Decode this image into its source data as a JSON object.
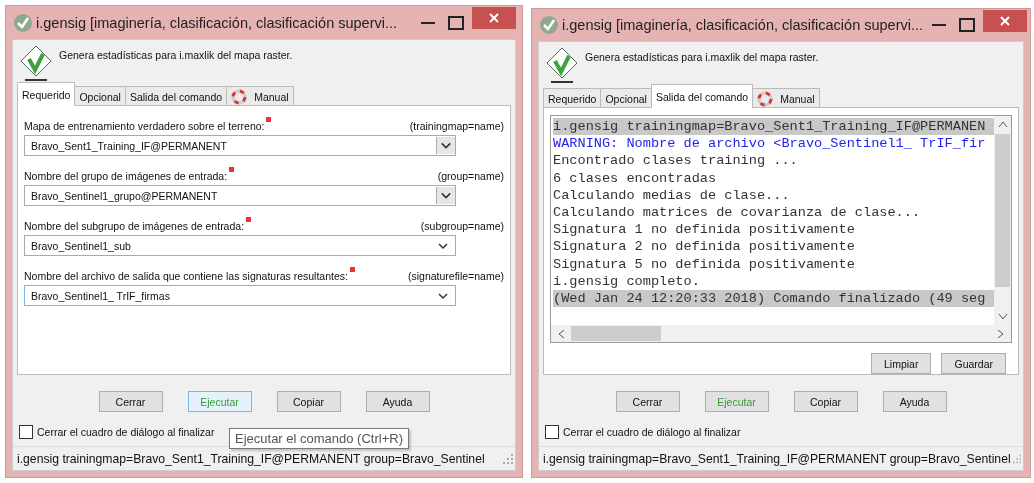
{
  "windows": [
    {
      "kind": "form",
      "title": "i.gensig [imaginería, clasificación, clasificación supervi...",
      "description": "Genera estadísticas para i.maxlik del mapa raster.",
      "tabs": [
        {
          "label": "Requerido",
          "selected": true,
          "kind": "text"
        },
        {
          "label": "Opcional",
          "selected": false,
          "kind": "text"
        },
        {
          "label": "Salida del comando",
          "selected": false,
          "kind": "text"
        },
        {
          "label": "Manual",
          "selected": false,
          "kind": "manual"
        }
      ],
      "fields": [
        {
          "label": "Mapa de entrenamiento verdadero sobre el terreno:",
          "required": true,
          "param": "(trainingmap=name)",
          "value": "Bravo_Sent1_Training_IF@PERMANENT",
          "kind": "select",
          "focused": false
        },
        {
          "label": "Nombre del grupo de imágenes de entrada:",
          "required": true,
          "param": "(group=name)",
          "value": "Bravo_Sentinel1_grupo@PERMANENT",
          "kind": "select",
          "focused": false
        },
        {
          "label": "Nombre del subgrupo de imágenes de entrada:",
          "required": true,
          "param": "(subgroup=name)",
          "value": "Bravo_Sentinel1_sub",
          "kind": "combo",
          "focused": false
        },
        {
          "label": "Nombre del archivo de salida que contiene las signaturas resultantes:",
          "required": true,
          "param": "(signaturefile=name)",
          "value": "Bravo_Sentinel1_ TrIF_firmas",
          "kind": "combo",
          "focused": true
        }
      ],
      "buttons": [
        {
          "label": "Cerrar",
          "focused": false,
          "kind": "plain"
        },
        {
          "label": "Ejecutar",
          "focused": true,
          "kind": "run"
        },
        {
          "label": "Copiar",
          "focused": false,
          "kind": "plain"
        },
        {
          "label": "Ayuda",
          "focused": false,
          "kind": "plain"
        }
      ],
      "close_checkbox": {
        "label": "Cerrar el cuadro de diálogo al finalizar",
        "checked": false
      },
      "tooltip": "Ejecutar el comando (Ctrl+R)",
      "status": "i.gensig trainingmap=Bravo_Sent1_Training_IF@PERMANENT group=Bravo_Sentinel"
    },
    {
      "kind": "output",
      "title": "i.gensig [imaginería, clasificación, clasificación supervi...",
      "description": "Genera estadísticas para i.maxlik del mapa raster.",
      "tabs": [
        {
          "label": "Requerido",
          "selected": false,
          "kind": "text"
        },
        {
          "label": "Opcional",
          "selected": false,
          "kind": "text"
        },
        {
          "label": "Salida del comando",
          "selected": true,
          "kind": "text"
        },
        {
          "label": "Manual",
          "selected": false,
          "kind": "manual"
        }
      ],
      "output_lines": [
        {
          "text": "i.gensig trainingmap=Bravo_Sent1_Training_IF@PERMANEN",
          "kind": "command"
        },
        {
          "text": "WARNING: Nombre de archivo <Bravo_Sentinel1_ TrIF_fir",
          "kind": "warning"
        },
        {
          "text": "Encontrado clases training ...",
          "kind": "normal"
        },
        {
          "text": "6 clases encontradas",
          "kind": "normal"
        },
        {
          "text": "Calculando medias de clase...",
          "kind": "normal"
        },
        {
          "text": "Calculando matrices de covarianza de clase...",
          "kind": "normal"
        },
        {
          "text": "Signatura 1 no definida positivamente",
          "kind": "normal"
        },
        {
          "text": "Signatura 2 no definida positivamente",
          "kind": "normal"
        },
        {
          "text": "Signatura 5 no definida positivamente",
          "kind": "normal"
        },
        {
          "text": "i.gensig completo.",
          "kind": "normal"
        },
        {
          "text": "(Wed Jan 24 12:20:33 2018) Comando finalizado (49 seg",
          "kind": "command"
        }
      ],
      "output_buttons": [
        "Limpiar",
        "Guardar"
      ],
      "buttons": [
        {
          "label": "Cerrar",
          "focused": false,
          "kind": "plain"
        },
        {
          "label": "Ejecutar",
          "focused": false,
          "kind": "run"
        },
        {
          "label": "Copiar",
          "focused": false,
          "kind": "plain"
        },
        {
          "label": "Ayuda",
          "focused": false,
          "kind": "plain"
        }
      ],
      "close_checkbox": {
        "label": "Cerrar el cuadro de diálogo al finalizar",
        "checked": false
      },
      "status": "i.gensig trainingmap=Bravo_Sent1_Training_IF@PERMANENT group=Bravo_Sentinel"
    }
  ]
}
